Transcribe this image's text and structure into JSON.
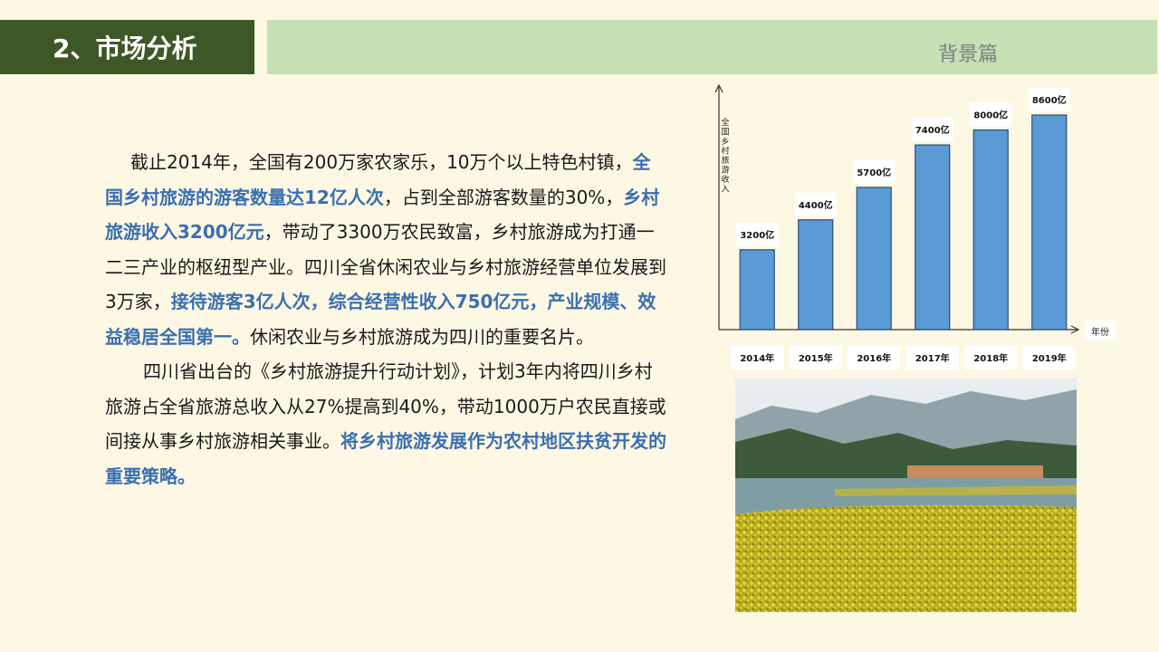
{
  "header": {
    "title": "2、市场分析",
    "section_label": "背景篇"
  },
  "paragraph1": {
    "s1": "截止2014年，全国有200万家农家乐，10万个以上特色村镇，",
    "h1": "全国乡村旅游的游客数量达12亿人次",
    "s2": "，占到全部游客数量的30%，",
    "h2": "乡村旅游收入3200亿元",
    "s3": "，带动了3300万农民致富，乡村旅游成为打通一二三产业的枢纽型产业。四川全省休闲农业与乡村旅游经营单位发展到3万家，",
    "h3": "接待游客3亿人次，综合经营性收入750亿元，产业规模、效益稳居全国第一。",
    "s4": "休闲农业与乡村旅游成为四川的重要名片。"
  },
  "paragraph2": {
    "s1": "四川省出台的《乡村旅游提升行动计划》，计划3年内将四川乡村旅游占全省旅游总收入从27%提高到40%，带动1000万户农民直接或间接从事乡村旅游相关事业。",
    "h1": "将乡村旅游发展作为农村地区扶贫开发的重要策略。"
  },
  "chart_data": {
    "type": "bar",
    "categories": [
      "2014年",
      "2015年",
      "2016年",
      "2017年",
      "2018年",
      "2019年"
    ],
    "values": [
      3200,
      4400,
      5700,
      7400,
      8000,
      8600
    ],
    "data_labels": [
      "3200亿",
      "4400亿",
      "5700亿",
      "7400亿",
      "8000亿",
      "8600亿"
    ],
    "ylabel": "全国乡村旅游收入",
    "xlabel": "年份",
    "ylim": [
      0,
      9000
    ],
    "bar_color": "#5b9bd5",
    "grid": false
  },
  "photo": {
    "icon": "landscape-photo-icon"
  },
  "colors": {
    "title_bg": "#3e5726",
    "section_bg": "#c6dfb4",
    "highlight": "#3b6fb0",
    "page_bg": "#fdf8e4"
  }
}
